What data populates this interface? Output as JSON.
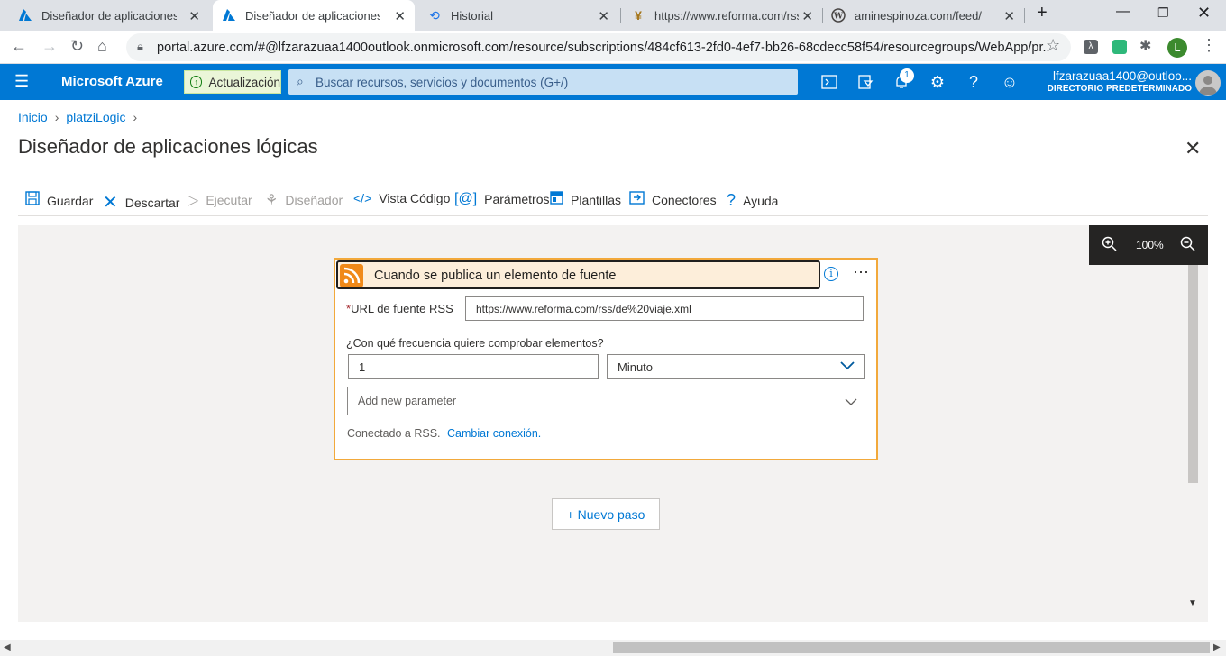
{
  "browser": {
    "tabs": [
      {
        "title": "Diseñador de aplicaciones lógi",
        "icon": "azure-icon"
      },
      {
        "title": "Diseñador de aplicaciones lógi",
        "icon": "azure-icon"
      },
      {
        "title": "Historial",
        "icon": "history-icon"
      },
      {
        "title": "https://www.reforma.com/rss/",
        "icon": "reforma-icon"
      },
      {
        "title": "aminespinoza.com/feed/",
        "icon": "wordpress-icon"
      }
    ],
    "url": "portal.azure.com/#@lfzarazuaa1400outlook.onmicrosoft.com/resource/subscriptions/484cf613-2fd0-4ef7-bb26-68cdecc58f54/resourcegroups/WebApp/pr...",
    "profile_initial": "L"
  },
  "azure": {
    "brand": "Microsoft Azure",
    "upgrade_label": "Actualización",
    "search_placeholder": "Buscar recursos, servicios y documentos (G+/)",
    "notification_count": "1",
    "account_email": "lfzarazuaa1400@outloo...",
    "account_directory": "DIRECTORIO PREDETERMINADO"
  },
  "page": {
    "breadcrumb": [
      "Inicio",
      "platziLogic"
    ],
    "title": "Diseñador de aplicaciones lógicas",
    "commands": {
      "save": "Guardar",
      "discard": "Descartar",
      "run": "Ejecutar",
      "designer": "Diseñador",
      "code_view": "Vista Código",
      "parameters": "Parámetros",
      "templates": "Plantillas",
      "connectors": "Conectores",
      "help": "Ayuda"
    },
    "zoom": "100%"
  },
  "trigger": {
    "title": "Cuando se publica un elemento de fuente",
    "required_mark": "*",
    "rss_url_label": "URL de fuente RSS",
    "rss_url_value": "https://www.reforma.com/rss/de%20viaje.xml",
    "frequency_question": "¿Con qué frecuencia quiere comprobar elementos?",
    "interval_value": "1",
    "frequency_value": "Minuto",
    "add_parameter_placeholder": "Add new parameter",
    "connected_text": "Conectado a RSS.",
    "change_connection": "Cambiar conexión."
  },
  "new_step_label": "+ Nuevo paso"
}
